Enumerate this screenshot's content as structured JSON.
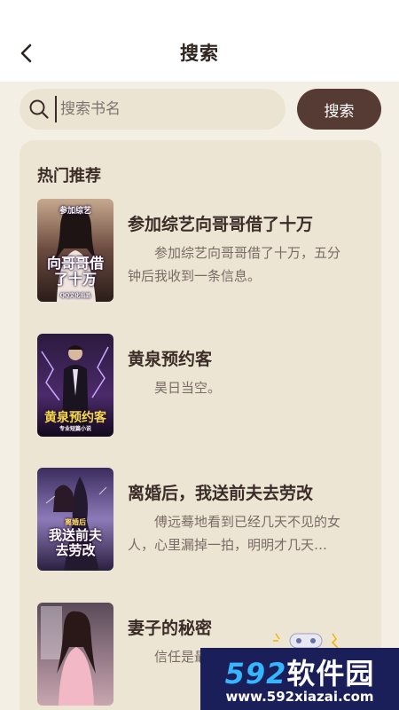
{
  "header": {
    "title": "搜索",
    "back_icon": "chevron-left-icon"
  },
  "search": {
    "placeholder": "搜索书名",
    "value": "",
    "button_label": "搜索"
  },
  "recommend": {
    "title": "热门推荐",
    "books": [
      {
        "title": "参加综艺向哥哥借了十万",
        "desc": "参加综艺向哥哥借了十万，五分钟后我收到一条信息。",
        "cover_text": "向哥哥借了十万",
        "cover_top": "参加综艺",
        "cover_bottom": "QQ文化出品"
      },
      {
        "title": "黄泉预约客",
        "desc": "昊日当空。",
        "cover_text": "黄泉预约客",
        "cover_top": "",
        "cover_bottom": "专业短篇小说"
      },
      {
        "title": "离婚后，我送前夫去劳改",
        "desc": "傅远蓦地看到已经几天不见的女人，心里漏掉一拍，明明才几天…",
        "cover_text": "我送前夫去劳改",
        "cover_top": "离婚后",
        "cover_bottom": ""
      },
      {
        "title": "妻子的秘密",
        "desc": "信任是最…失去的东西…",
        "cover_text": "",
        "cover_top": "",
        "cover_bottom": ""
      }
    ]
  },
  "watermark": {
    "brand_num": "592",
    "brand_text": "软件园",
    "url": "www.592xiazai.com"
  },
  "colors": {
    "background": "#f4efe4",
    "panel": "#ede5d3",
    "accent": "#563b34",
    "search_bg": "#ece4d2"
  }
}
